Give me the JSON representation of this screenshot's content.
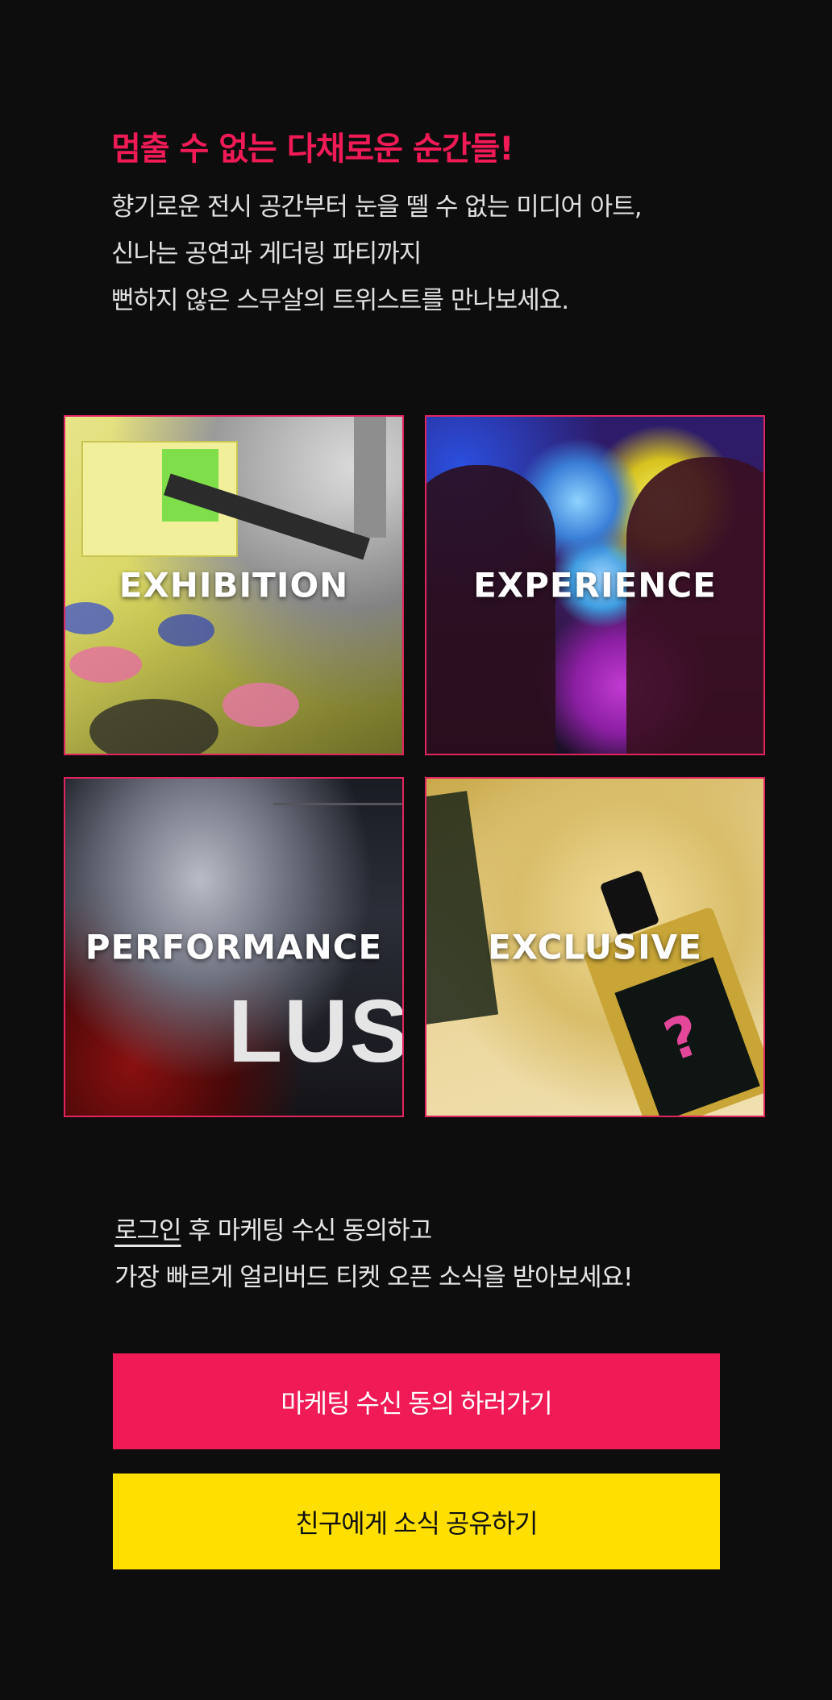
{
  "headline": "멈출 수 없는 다채로운 순간들!",
  "intro": {
    "lines": [
      "향기로운 전시 공간부터 눈을 뗄 수 없는 미디어 아트,",
      "신나는 공연과 게더링 파티까지",
      "뻔하지 않은 스무살의 트위스트를 만나보세요."
    ]
  },
  "tiles": [
    {
      "label": "EXHIBITION"
    },
    {
      "label": "EXPERIENCE"
    },
    {
      "label": "PERFORMANCE"
    },
    {
      "label": "EXCLUSIVE"
    }
  ],
  "notice": {
    "login_link": "로그인",
    "line1_rest": " 후 마케팅 수신 동의하고",
    "line2": "가장 빠르게 얼리버드 티켓 오픈 소식을 받아보세요!"
  },
  "buttons": {
    "consent_label": "마케팅 수신 동의 하러가기",
    "share_label": "친구에게 소식 공유하기"
  },
  "colors": {
    "accent_pink": "#ef1a56",
    "accent_yellow": "#ffdf00",
    "background": "#0d0d0d"
  }
}
